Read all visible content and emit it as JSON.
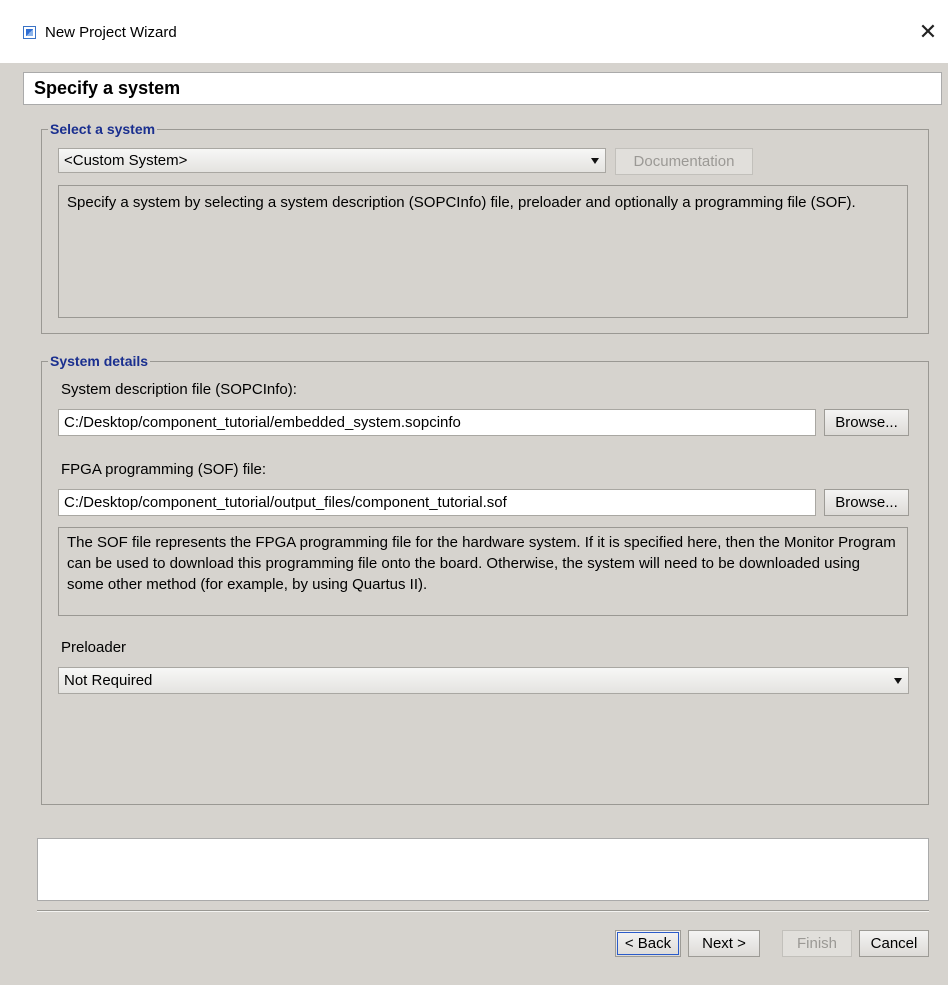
{
  "window": {
    "title": "New Project Wizard",
    "close_glyph": "✕",
    "app_icon": "wizard-app-icon"
  },
  "page": {
    "heading": "Specify a system"
  },
  "select_system": {
    "legend": "Select a system",
    "selected_value": "<Custom System>",
    "documentation_label": "Documentation",
    "description": "Specify a system by selecting a system description (SOPCInfo) file, preloader and optionally a programming file (SOF)."
  },
  "system_details": {
    "legend": "System details",
    "sopcinfo_label": "System description file (SOPCInfo):",
    "sopcinfo_value": "C:/Desktop/component_tutorial/embedded_system.sopcinfo",
    "browse_label": "Browse...",
    "sof_label": "FPGA programming (SOF) file:",
    "sof_value": "C:/Desktop/component_tutorial/output_files/component_tutorial.sof",
    "sof_description": "The SOF file represents the FPGA programming file for the hardware system. If it is specified here, then the Monitor Program can be used to download this programming file onto the board. Otherwise, the system will need to be downloaded using some other method (for example, by using Quartus II).",
    "preloader_label": "Preloader",
    "preloader_value": "Not Required"
  },
  "buttons": {
    "back": "< Back",
    "next": "Next >",
    "finish": "Finish",
    "cancel": "Cancel"
  },
  "colors": {
    "dialog_bg": "#d6d3ce",
    "legend_text": "#1a2f8f",
    "disabled_text": "#9b9995"
  }
}
